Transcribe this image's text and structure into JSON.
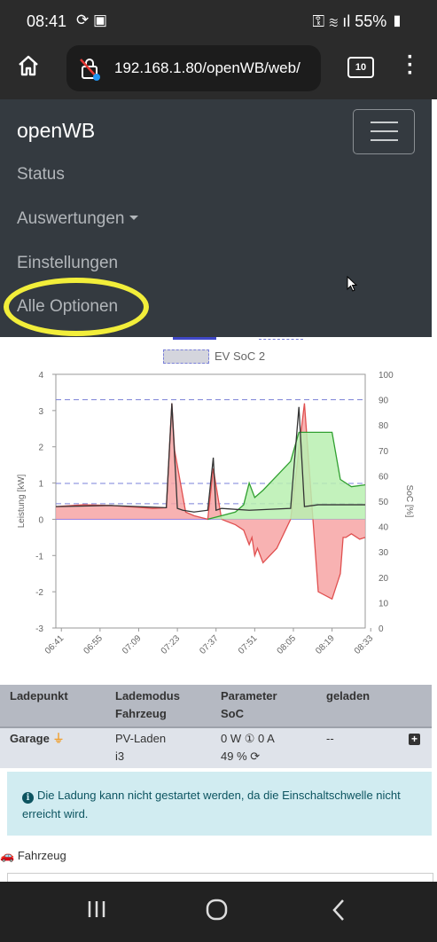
{
  "status_bar": {
    "time": "08:41",
    "battery": "55%"
  },
  "browser": {
    "url": "192.168.1.80/openWB/web/",
    "tab_count": "10"
  },
  "navbar": {
    "brand": "openWB",
    "links": [
      "Status",
      "Auswertungen",
      "Einstellungen",
      "Alle Optionen"
    ]
  },
  "legend": {
    "ev_soc2": "EV SoC 2"
  },
  "chart_data": {
    "type": "area",
    "xlabel": "",
    "ylabel": "Leistung [kW]",
    "y2label": "SoC [%]",
    "ylim": [
      -3,
      4
    ],
    "y2lim": [
      0,
      100
    ],
    "x_ticks": [
      "06:41",
      "06:55",
      "07:09",
      "07:23",
      "07:37",
      "07:51",
      "08:05",
      "08:19",
      "08:33"
    ],
    "y_ticks": [
      "4",
      "3",
      "2",
      "1",
      "0",
      "-1",
      "-2",
      "-3"
    ],
    "y2_ticks": [
      "100",
      "90",
      "80",
      "70",
      "60",
      "50",
      "40",
      "30",
      "20",
      "10",
      "0"
    ],
    "series": [
      {
        "color": "#e05050",
        "fill": "#f7a5a5",
        "x": [
          0,
          10,
          20,
          30,
          35,
          40,
          41,
          42,
          43,
          47,
          50,
          55,
          57,
          60,
          65,
          68,
          70,
          71,
          72,
          73,
          75,
          80,
          85,
          90,
          95,
          100,
          103,
          104,
          105,
          107,
          110,
          112
        ],
        "y": [
          0.35,
          0.4,
          0.38,
          0.33,
          0.3,
          0.32,
          1.8,
          3.2,
          1.9,
          0.2,
          0.1,
          0.0,
          1.4,
          0.0,
          -0.15,
          -0.3,
          -0.7,
          -0.5,
          -1.0,
          -0.8,
          -1.2,
          -0.8,
          0.0,
          3.2,
          -2.0,
          -2.2,
          -1.5,
          -0.5,
          -0.5,
          -0.4,
          -0.55,
          -0.5
        ]
      },
      {
        "color": "#30a030",
        "fill": "#b8f0b0",
        "x": [
          55,
          60,
          65,
          68,
          70,
          72,
          75,
          80,
          85,
          88,
          95,
          100,
          103,
          107,
          112
        ],
        "y": [
          0.0,
          0.1,
          0.2,
          0.4,
          1.0,
          0.6,
          0.8,
          1.2,
          1.6,
          2.4,
          2.4,
          2.4,
          1.1,
          0.9,
          0.95
        ]
      },
      {
        "color": "#333333",
        "x": [
          0,
          20,
          40,
          42,
          44,
          46,
          50,
          55,
          57,
          58,
          60,
          70,
          85,
          88,
          90,
          95,
          112
        ],
        "y": [
          0.35,
          0.38,
          0.32,
          3.2,
          0.3,
          0.25,
          0.2,
          0.25,
          1.7,
          0.25,
          0.3,
          0.25,
          0.3,
          3.1,
          0.35,
          0.4,
          0.4
        ]
      }
    ],
    "ev_soc_dashed_percent": [
      90,
      57,
      49
    ]
  },
  "table": {
    "headers": [
      [
        "Ladepunkt",
        ""
      ],
      [
        "Lademodus",
        "Fahrzeug"
      ],
      [
        "Parameter",
        "SoC"
      ],
      [
        "geladen",
        ""
      ]
    ],
    "row": {
      "ladepunkt": "Garage",
      "modus": "PV-Laden",
      "fahrzeug": "i3",
      "param": "0 W ① 0 A",
      "soc": "49 %",
      "geladen": "--"
    }
  },
  "alert": {
    "text": "Die Ladung kann nicht gestartet werden, da die Einschaltschwelle nicht erreicht wird."
  },
  "section": {
    "fahrzeug": "Fahrzeug"
  }
}
